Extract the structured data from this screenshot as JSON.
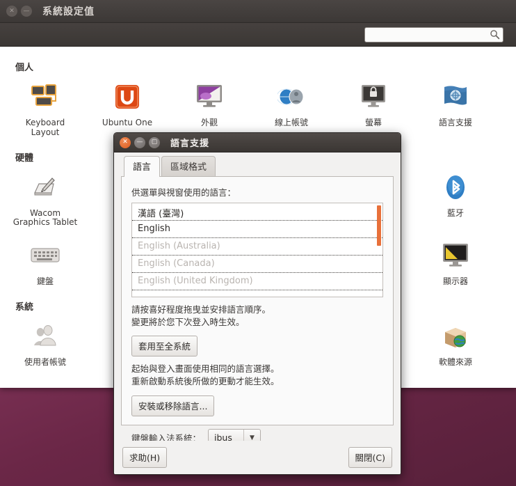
{
  "main_window": {
    "title": "系統設定值",
    "window_buttons": [
      {
        "name": "close-icon",
        "glyph": "✕"
      },
      {
        "name": "minimize-icon",
        "glyph": "—"
      }
    ],
    "search": {
      "value": "",
      "placeholder": "",
      "icon": "search-icon"
    },
    "categories": [
      {
        "title": "個人",
        "items": [
          {
            "label": "Keyboard Layout",
            "icon": "keyboard-layout-icon"
          },
          {
            "label": "Ubuntu One",
            "icon": "ubuntu-one-icon"
          },
          {
            "label": "外觀",
            "icon": "appearance-icon"
          },
          {
            "label": "線上帳號",
            "icon": "online-accounts-icon"
          },
          {
            "label": "螢幕",
            "icon": "screen-lock-icon"
          },
          {
            "label": "語言支援",
            "icon": "language-support-icon"
          }
        ]
      },
      {
        "title": "硬體",
        "items": [
          {
            "label": "Wacom Graphics Tablet",
            "icon": "wacom-tablet-icon"
          },
          {
            "label": "藍牙",
            "icon": "bluetooth-icon"
          },
          {
            "label": "鍵盤",
            "icon": "keyboard-icon"
          },
          {
            "label": "顯示器",
            "icon": "displays-icon"
          }
        ]
      },
      {
        "title": "系統",
        "items": [
          {
            "label": "使用者帳號",
            "icon": "user-accounts-icon"
          },
          {
            "label": "軟體來源",
            "icon": "software-sources-icon"
          }
        ]
      }
    ]
  },
  "dialog": {
    "title": "語言支援",
    "window_buttons": [
      {
        "name": "close-icon",
        "glyph": "✕"
      },
      {
        "name": "minimize-icon",
        "glyph": "—"
      },
      {
        "name": "maximize-icon",
        "glyph": "▢"
      }
    ],
    "tabs": [
      {
        "label": "語言",
        "active": true
      },
      {
        "label": "區域格式",
        "active": false
      }
    ],
    "language_tab": {
      "list_label": "供選單與視窗使用的語言：",
      "languages": [
        {
          "name": "漢語 (臺灣)",
          "enabled": true
        },
        {
          "name": "English",
          "enabled": true
        },
        {
          "name": "English (Australia)",
          "enabled": false
        },
        {
          "name": "English (Canada)",
          "enabled": false
        },
        {
          "name": "English (United Kingdom)",
          "enabled": false
        }
      ],
      "drag_hint_line1": "請按喜好程度拖曳並安排語言順序。",
      "drag_hint_line2": "變更將於您下次登入時生效。",
      "apply_system_wide_button": "套用至全系統",
      "apply_hint_line1": "起始與登入畫面使用相同的語言選擇。",
      "apply_hint_line2": "重新啟動系統後所做的更動才能生效。",
      "install_remove_button": "安裝或移除語言...",
      "input_method_label": "鍵盤輸入法系統：",
      "input_method_value": "ibus",
      "input_method_options": [
        "ibus"
      ]
    },
    "footer": {
      "help_button": "求助(H)",
      "close_button": "關閉(C)"
    }
  },
  "colors": {
    "accent_orange": "#e8703a",
    "titlebar_dark": "#3c3836",
    "desktop_purple": "#7a3257"
  }
}
